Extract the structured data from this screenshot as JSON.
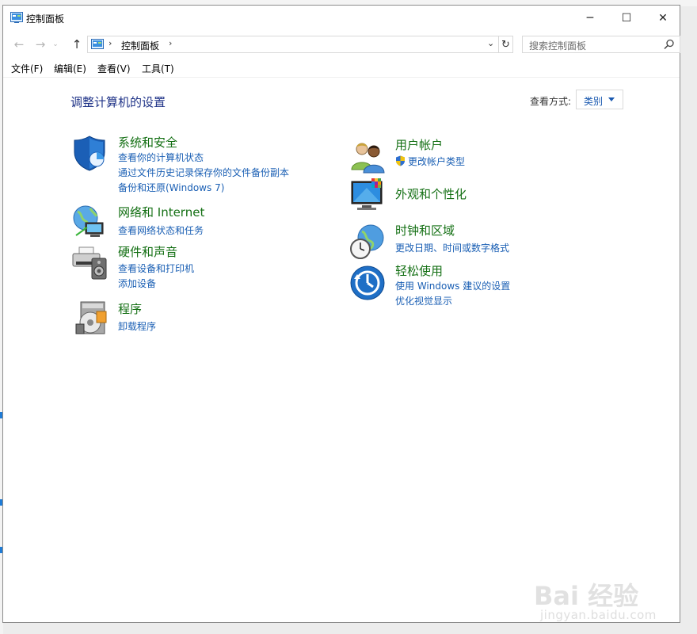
{
  "window": {
    "title": "控制面板",
    "buttons": {
      "minimize": "─",
      "maximize": "☐",
      "close": "✕"
    }
  },
  "nav": {
    "back_icon": "←",
    "forward_icon": "→",
    "history_icon": "⌄",
    "up_icon": "↑",
    "address_text": "控制面板",
    "address_separator": "›",
    "dropdown_icon": "⌄",
    "refresh_icon": "↻",
    "search_placeholder": "搜索控制面板"
  },
  "menu": [
    {
      "label": "文件(F)"
    },
    {
      "label": "编辑(E)"
    },
    {
      "label": "查看(V)"
    },
    {
      "label": "工具(T)"
    }
  ],
  "main": {
    "heading": "调整计算机的设置",
    "view_by_label": "查看方式:",
    "view_by_value": "类别"
  },
  "categories": {
    "system": {
      "title": "系统和安全",
      "links": [
        "查看你的计算机状态",
        "通过文件历史记录保存你的文件备份副本",
        "备份和还原(Windows 7)"
      ],
      "icon": "shield-icon"
    },
    "network": {
      "title": "网络和 Internet",
      "links": [
        "查看网络状态和任务"
      ],
      "icon": "network-globe-icon"
    },
    "hardware": {
      "title": "硬件和声音",
      "links": [
        "查看设备和打印机",
        "添加设备"
      ],
      "icon": "printer-speaker-icon"
    },
    "programs": {
      "title": "程序",
      "links": [
        "卸载程序"
      ],
      "icon": "programs-disc-icon"
    },
    "users": {
      "title": "用户帐户",
      "links": [
        "更改帐户类型"
      ],
      "icon": "users-icon"
    },
    "appearance": {
      "title": "外观和个性化",
      "links": [],
      "icon": "monitor-palette-icon"
    },
    "clock": {
      "title": "时钟和区域",
      "links": [
        "更改日期、时间或数字格式"
      ],
      "icon": "clock-globe-icon"
    },
    "ease": {
      "title": "轻松使用",
      "links": [
        "使用 Windows 建议的设置",
        "优化视觉显示"
      ],
      "icon": "ease-of-access-icon"
    }
  },
  "watermark": {
    "brand": "Bai 经验",
    "url": "jingyan.baidu.com"
  },
  "colors": {
    "heading": "#1e3287",
    "category_title": "#136f13",
    "link": "#1a5fb4"
  }
}
